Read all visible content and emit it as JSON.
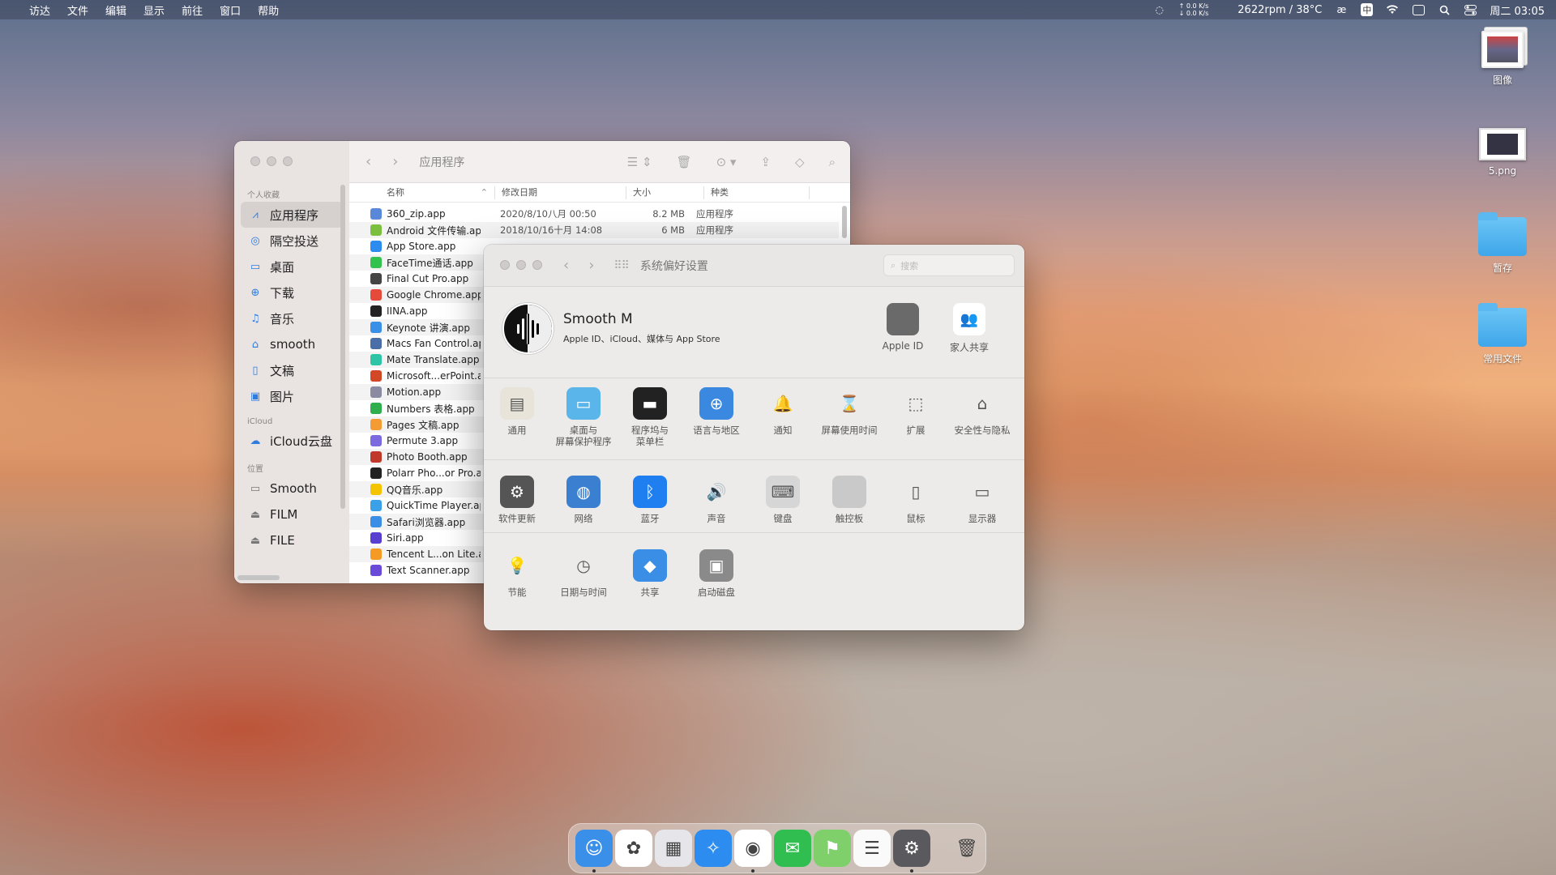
{
  "menubar": {
    "apple": "",
    "items": [
      "访达",
      "文件",
      "编辑",
      "显示",
      "前往",
      "窗口",
      "帮助"
    ],
    "net_up": "↑ 0.0 K/s",
    "net_down": "↓ 0.0 K/s",
    "fan": "2622rpm / 38°C",
    "ime": "中",
    "clock": "周二 03:05"
  },
  "desktop": [
    {
      "label": "图像",
      "icon": "image-stack-icon"
    },
    {
      "label": "5.png",
      "icon": "png-file-icon"
    },
    {
      "label": "暂存",
      "icon": "folder-icon"
    },
    {
      "label": "常用文件",
      "icon": "folder-icon"
    }
  ],
  "finder": {
    "title": "应用程序",
    "sidebar": {
      "favorites_header": "个人收藏",
      "favorites": [
        {
          "label": "应用程序",
          "icon": "apps-icon",
          "glyph": "⩘",
          "active": true
        },
        {
          "label": "隔空投送",
          "icon": "airdrop-icon",
          "glyph": "◎"
        },
        {
          "label": "桌面",
          "icon": "desktop-icon",
          "glyph": "▭"
        },
        {
          "label": "下载",
          "icon": "download-icon",
          "glyph": "⊕"
        },
        {
          "label": "音乐",
          "icon": "music-icon",
          "glyph": "♫"
        },
        {
          "label": "smooth",
          "icon": "home-icon",
          "glyph": "⌂"
        },
        {
          "label": "文稿",
          "icon": "document-icon",
          "glyph": "▯"
        },
        {
          "label": "图片",
          "icon": "pictures-icon",
          "glyph": "▣"
        }
      ],
      "icloud_header": "iCloud",
      "icloud": [
        {
          "label": "iCloud云盘",
          "icon": "cloud-icon",
          "glyph": "☁"
        }
      ],
      "locations_header": "位置",
      "locations": [
        {
          "label": "Smooth",
          "icon": "disk-icon",
          "glyph": "▭"
        },
        {
          "label": "FILM",
          "icon": "disk-icon",
          "glyph": "⏏"
        },
        {
          "label": "FILE",
          "icon": "disk-icon",
          "glyph": "⏏"
        }
      ]
    },
    "columns": {
      "name": "名称",
      "date": "修改日期",
      "size": "大小",
      "kind": "种类"
    },
    "files": [
      {
        "name": "360_zip.app",
        "date": "2020/8/10八月 00:50",
        "size": "8.2 MB",
        "kind": "应用程序",
        "color": "#5a88d8"
      },
      {
        "name": "Android 文件传输.app",
        "date": "2018/10/16十月 14:08",
        "size": "6 MB",
        "kind": "应用程序",
        "color": "#7cbf3c"
      },
      {
        "name": "App Store.app",
        "date": "",
        "size": "",
        "kind": "",
        "color": "#2d8cf0"
      },
      {
        "name": "FaceTime通话.app",
        "date": "",
        "size": "",
        "kind": "",
        "color": "#33c24d"
      },
      {
        "name": "Final Cut Pro.app",
        "date": "",
        "size": "",
        "kind": "",
        "color": "#444"
      },
      {
        "name": "Google Chrome.app",
        "date": "",
        "size": "",
        "kind": "",
        "color": "#e64a3b"
      },
      {
        "name": "IINA.app",
        "date": "",
        "size": "",
        "kind": "",
        "color": "#222"
      },
      {
        "name": "Keynote 讲演.app",
        "date": "",
        "size": "",
        "kind": "",
        "color": "#3a8fe6"
      },
      {
        "name": "Macs Fan Control.app",
        "date": "",
        "size": "",
        "kind": "",
        "color": "#4a6fa8"
      },
      {
        "name": "Mate Translate.app",
        "date": "",
        "size": "",
        "kind": "",
        "color": "#2ec4a6"
      },
      {
        "name": "Microsoft...erPoint.app",
        "date": "",
        "size": "",
        "kind": "",
        "color": "#d24726"
      },
      {
        "name": "Motion.app",
        "date": "",
        "size": "",
        "kind": "",
        "color": "#8a8aa0"
      },
      {
        "name": "Numbers 表格.app",
        "date": "",
        "size": "",
        "kind": "",
        "color": "#2fae4e"
      },
      {
        "name": "Pages 文稿.app",
        "date": "",
        "size": "",
        "kind": "",
        "color": "#f39c34"
      },
      {
        "name": "Permute 3.app",
        "date": "",
        "size": "",
        "kind": "",
        "color": "#7a6ae0"
      },
      {
        "name": "Photo Booth.app",
        "date": "",
        "size": "",
        "kind": "",
        "color": "#c0392b"
      },
      {
        "name": "Polarr Pho...or Pro.app",
        "date": "",
        "size": "",
        "kind": "",
        "color": "#222"
      },
      {
        "name": "QQ音乐.app",
        "date": "",
        "size": "",
        "kind": "",
        "color": "#f5c400"
      },
      {
        "name": "QuickTime Player.app",
        "date": "",
        "size": "",
        "kind": "",
        "color": "#3aa0e8"
      },
      {
        "name": "Safari浏览器.app",
        "date": "",
        "size": "",
        "kind": "",
        "color": "#3a8ee6"
      },
      {
        "name": "Siri.app",
        "date": "",
        "size": "",
        "kind": "",
        "color": "#5b3fd0"
      },
      {
        "name": "Tencent L...on Lite.app",
        "date": "",
        "size": "",
        "kind": "",
        "color": "#f59a23"
      },
      {
        "name": "Text Scanner.app",
        "date": "",
        "size": "",
        "kind": "",
        "color": "#6a4ad8"
      }
    ]
  },
  "prefs": {
    "title": "系统偏好设置",
    "search_placeholder": "搜索",
    "user_name": "Smooth M",
    "user_sub": "Apple ID、iCloud、媒体与 App Store",
    "apple_id": "Apple ID",
    "family": "家人共享",
    "row1": [
      {
        "label": "通用",
        "label2": "",
        "icon": "general-icon",
        "color": "#e8e4da",
        "glyph": "▤"
      },
      {
        "label": "桌面与",
        "label2": "屏幕保护程序",
        "icon": "desktop-screensaver-icon",
        "color": "#5ab6ea",
        "glyph": "▭"
      },
      {
        "label": "程序坞与",
        "label2": "菜单栏",
        "icon": "dock-menubar-icon",
        "color": "#222",
        "glyph": "▬"
      },
      {
        "label": "语言与地区",
        "label2": "",
        "icon": "language-region-icon",
        "color": "#3a88e0",
        "glyph": "⊕"
      },
      {
        "label": "通知",
        "label2": "",
        "icon": "notifications-icon",
        "color": "transparent",
        "glyph": "🔔"
      },
      {
        "label": "屏幕使用时间",
        "label2": "",
        "icon": "screen-time-icon",
        "color": "transparent",
        "glyph": "⌛"
      },
      {
        "label": "扩展",
        "label2": "",
        "icon": "extensions-icon",
        "color": "transparent",
        "glyph": "⬚"
      },
      {
        "label": "安全性与隐私",
        "label2": "",
        "icon": "security-privacy-icon",
        "color": "transparent",
        "glyph": "⌂"
      }
    ],
    "row2": [
      {
        "label": "软件更新",
        "icon": "software-update-icon",
        "color": "#555",
        "glyph": "⚙"
      },
      {
        "label": "网络",
        "icon": "network-icon",
        "color": "#3a7fd0",
        "glyph": "◍"
      },
      {
        "label": "蓝牙",
        "icon": "bluetooth-icon",
        "color": "#1f7ff0",
        "glyph": "ᛒ"
      },
      {
        "label": "声音",
        "icon": "sound-icon",
        "color": "transparent",
        "glyph": "🔊"
      },
      {
        "label": "键盘",
        "icon": "keyboard-icon",
        "color": "#d6d6d6",
        "glyph": "⌨"
      },
      {
        "label": "触控板",
        "icon": "trackpad-icon",
        "color": "#c9c9c9",
        "glyph": ""
      },
      {
        "label": "鼠标",
        "icon": "mouse-icon",
        "color": "transparent",
        "glyph": "▯"
      },
      {
        "label": "显示器",
        "icon": "display-icon",
        "color": "transparent",
        "glyph": "▭"
      }
    ],
    "row3": [
      {
        "label": "节能",
        "icon": "energy-saver-icon",
        "color": "transparent",
        "glyph": "💡"
      },
      {
        "label": "日期与时间",
        "icon": "date-time-icon",
        "color": "transparent",
        "glyph": "◷"
      },
      {
        "label": "共享",
        "icon": "sharing-icon",
        "color": "#3a8ee6",
        "glyph": "◆"
      },
      {
        "label": "启动磁盘",
        "icon": "startup-disk-icon",
        "color": "#8a8a8a",
        "glyph": "▣"
      }
    ]
  },
  "dock": [
    {
      "icon": "finder-icon",
      "color": "#3a8fe8",
      "glyph": "☺",
      "running": true
    },
    {
      "icon": "photos-icon",
      "color": "#fff",
      "glyph": "✿",
      "running": false
    },
    {
      "icon": "launchpad-icon",
      "color": "#e6e6ea",
      "glyph": "▦",
      "running": false
    },
    {
      "icon": "safari-icon",
      "color": "#2d8cf0",
      "glyph": "✧",
      "running": false
    },
    {
      "icon": "chrome-icon",
      "color": "#fff",
      "glyph": "◉",
      "running": true
    },
    {
      "icon": "wechat-icon",
      "color": "#2fbe4f",
      "glyph": "✉",
      "running": false
    },
    {
      "icon": "maps-icon",
      "color": "#7fd06a",
      "glyph": "⚑",
      "running": false
    },
    {
      "icon": "reminders-icon",
      "color": "#fafafa",
      "glyph": "☰",
      "running": false
    },
    {
      "icon": "system-preferences-icon",
      "color": "#5a5a5e",
      "glyph": "⚙",
      "running": true
    },
    {
      "icon": "trash-icon",
      "color": "transparent",
      "glyph": "🗑",
      "running": false
    }
  ]
}
